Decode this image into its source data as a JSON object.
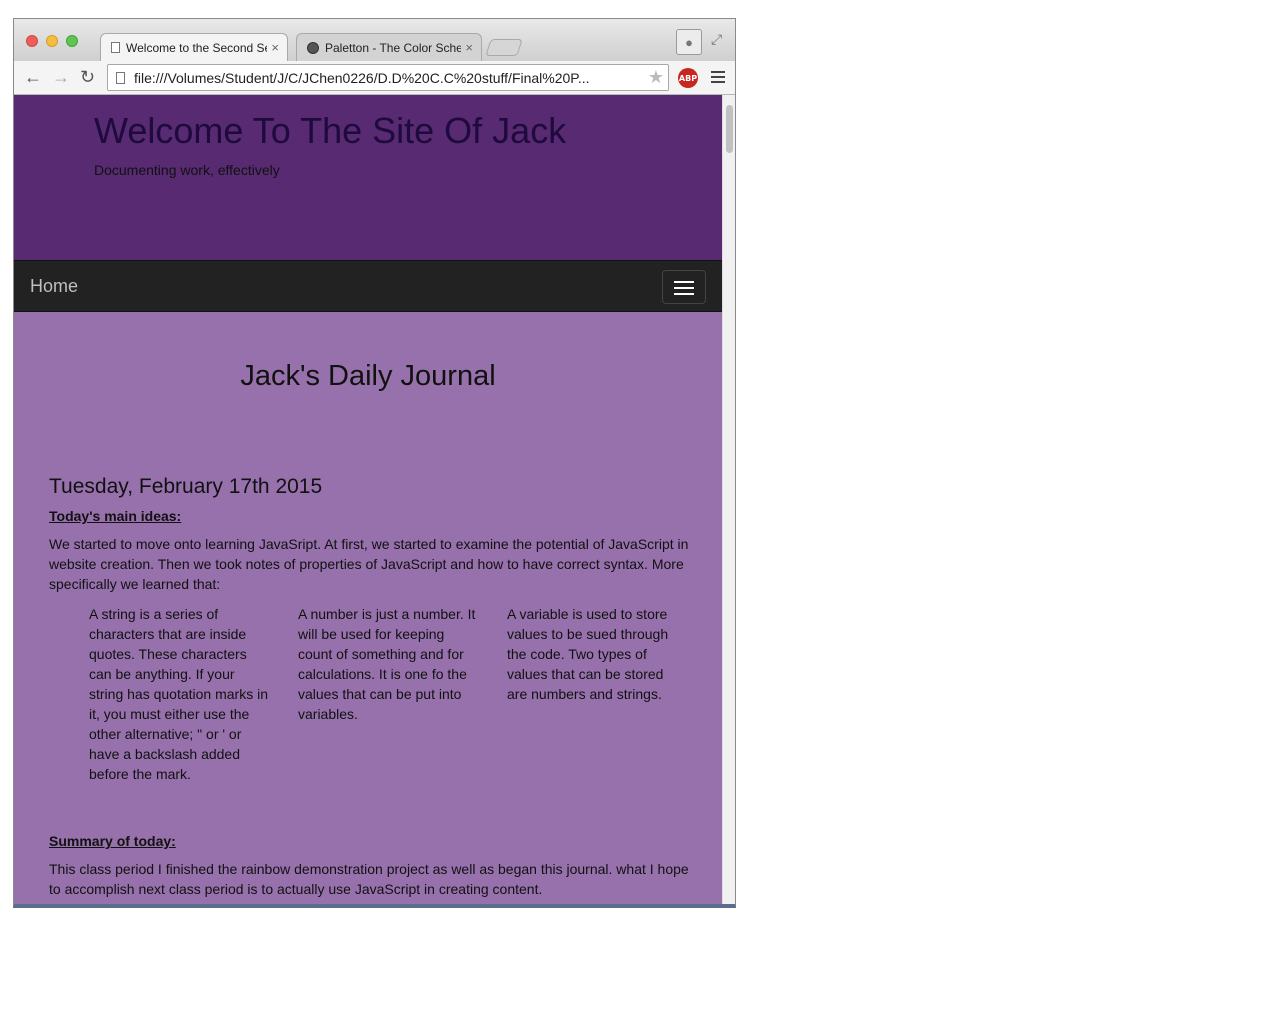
{
  "browser": {
    "tabs": [
      {
        "title": "Welcome to the Second Se",
        "active": true
      },
      {
        "title": "Paletton - The Color Schen",
        "active": false
      }
    ],
    "close_glyph": "×",
    "url": "file:///Volumes/Student/J/C/JChen0226/D.D%20C.C%20stuff/Final%20P...",
    "extension_label": "ABP",
    "icons": [
      "back-arrow-icon",
      "forward-arrow-icon",
      "reload-icon",
      "star-icon",
      "menu-icon",
      "profile-icon"
    ]
  },
  "site": {
    "title": "Welcome To The Site Of Jack",
    "subtitle": "Documenting work, effectively",
    "nav_home": "Home",
    "colors": {
      "header": "#572a71",
      "nav": "#222222",
      "content": "#9771ac"
    }
  },
  "journal": {
    "heading": "Jack's Daily Journal",
    "entry_date": "Tuesday, February 17th 2015",
    "main_ideas_label": "Today's main ideas:",
    "intro": "We started to move onto learning JavaSript. At first, we started to examine the potential of JavaScript in website creation. Then we took notes of properties of JavaScript and how to have correct syntax. More specifically we learned that:",
    "columns": [
      "A string is a series of characters that are inside quotes. These characters can be anything. If your string has quotation marks in it, you must either use the other alternative; \" or ' or have a backslash added before the mark.",
      "A number is just a number. It will be used for keeping count of something and for calculations. It is one fo the values that can be put into variables.",
      "A variable is used to store values to be sued through the code. Two types of values that can be stored are numbers and strings."
    ],
    "summary_label": "Summary of today:",
    "summary": "This class period I finished the rainbow demonstration project as well as began this journal. what I hope to accomplish next class period is to actually use JavaScript in creating content."
  }
}
